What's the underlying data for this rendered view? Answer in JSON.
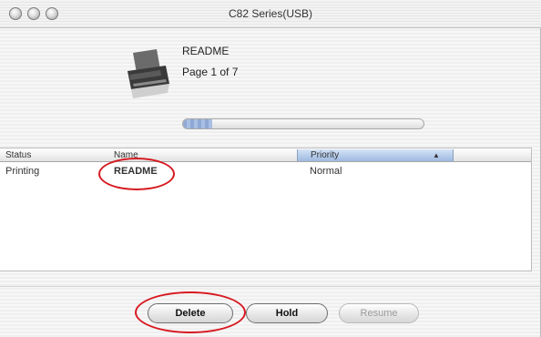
{
  "window": {
    "title": "C82 Series(USB)"
  },
  "job": {
    "name": "README",
    "page": "Page 1 of 7",
    "progress": 0.12
  },
  "table": {
    "columns": [
      {
        "label": "Status"
      },
      {
        "label": "Name"
      },
      {
        "label": "Priority"
      }
    ],
    "rows": [
      {
        "status": "Printing",
        "name": "README",
        "priority": "Normal"
      }
    ]
  },
  "buttons": {
    "delete": "Delete",
    "hold": "Hold",
    "resume": "Resume"
  },
  "colors": {
    "highlight": "#d71920",
    "progress": "#8fa9d4"
  }
}
